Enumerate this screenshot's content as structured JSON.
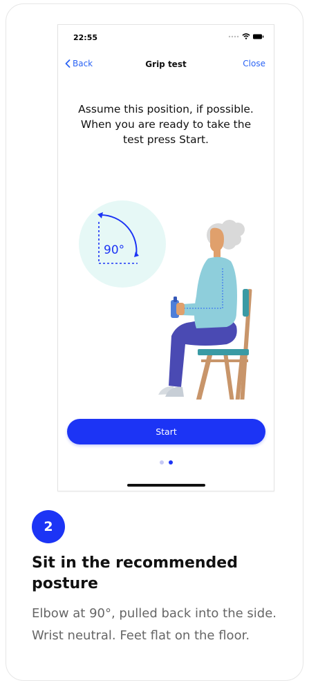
{
  "status_bar": {
    "time": "22:55",
    "icons": [
      "signal-icon",
      "wifi-icon",
      "battery-icon"
    ]
  },
  "nav": {
    "back_label": "Back",
    "title": "Grip test",
    "close_label": "Close"
  },
  "instruction": "Assume this position, if possible. When you are ready to take the test press Start.",
  "illustration": {
    "angle_label": "90°"
  },
  "start_button": {
    "label": "Start"
  },
  "pagination": {
    "total": 2,
    "current": 2
  },
  "step": {
    "number": "2",
    "title": "Sit in the recommended posture",
    "description": "Elbow at 90°, pulled back into the side. Wrist neutral. Feet flat on the floor."
  },
  "colors": {
    "accent": "#1c34f5",
    "link": "#2a63f5",
    "circle": "#e6f8f6",
    "shirt": "#8ecedb",
    "trousers": "#4a4ab3",
    "chair": "#c8956a",
    "seat": "#3a9aa4"
  }
}
